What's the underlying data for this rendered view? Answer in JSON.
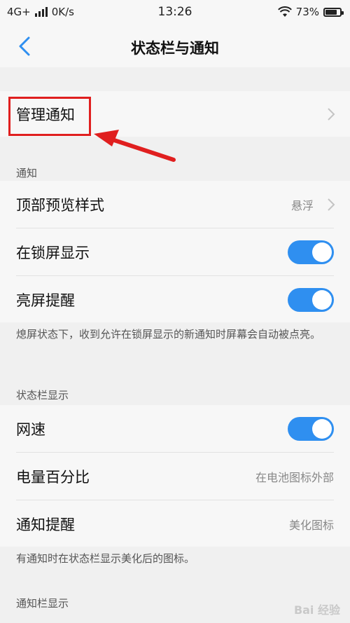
{
  "status_bar": {
    "network": "4G+",
    "speed": "0K/s",
    "time": "13:26",
    "battery": "73%"
  },
  "app_bar": {
    "title": "状态栏与通知"
  },
  "manage": {
    "label": "管理通知"
  },
  "notifications": {
    "header": "通知",
    "preview_style": {
      "label": "顶部预览样式",
      "value": "悬浮"
    },
    "lock_screen": {
      "label": "在锁屏显示",
      "enabled": true
    },
    "wake_screen": {
      "label": "亮屏提醒",
      "enabled": true
    },
    "note": "熄屏状态下，收到允许在锁屏显示的新通知时屏幕会自动被点亮。"
  },
  "status_display": {
    "header": "状态栏显示",
    "net_speed": {
      "label": "网速",
      "enabled": true
    },
    "battery_pct": {
      "label": "电量百分比",
      "value": "在电池图标外部"
    },
    "notif_alert": {
      "label": "通知提醒",
      "value": "美化图标"
    },
    "note": "有通知时在状态栏显示美化后的图标。"
  },
  "shade_display": {
    "header": "通知栏显示"
  },
  "watermark": "Bai 经验",
  "colors": {
    "accent": "#2f8ff0",
    "annotation": "#e01f1f"
  }
}
